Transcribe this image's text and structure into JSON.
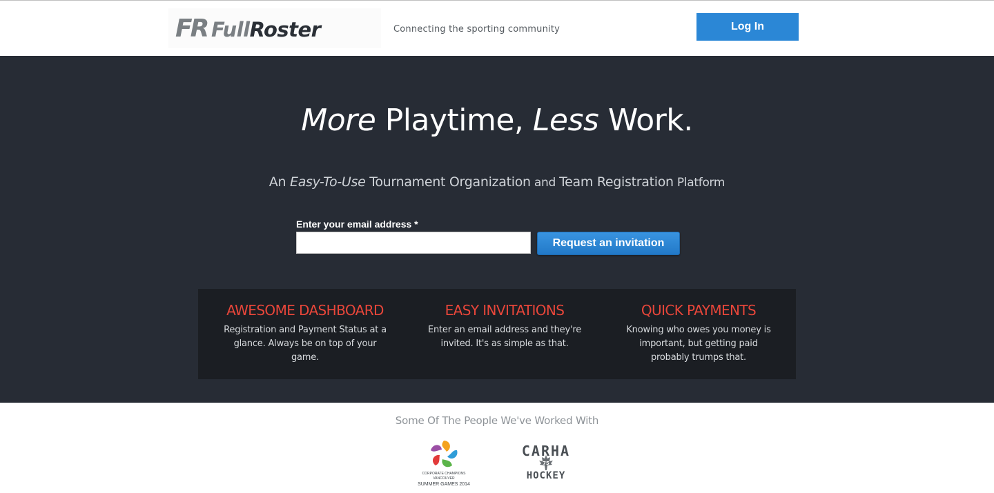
{
  "header": {
    "logo_mark": "FR",
    "logo_full": "Full",
    "logo_roster": "Roster",
    "tagline": "Connecting the sporting community",
    "login_label": "Log In"
  },
  "hero": {
    "title": {
      "w1": "More",
      "w2": " Playtime, ",
      "w3": "Less",
      "w4": " Work."
    },
    "subtitle": {
      "p1": "An ",
      "p2": "Easy-To-Use",
      "p3": " Tournament Organization",
      "p4": " and ",
      "p5": "Team Registration",
      "p6": " Platform"
    },
    "email_label": "Enter your email address *",
    "email_value": "",
    "invite_label": "Request an invitation"
  },
  "features": [
    {
      "title": "AWESOME DASHBOARD",
      "desc": "Registration and Payment Status at a glance. Always be on top of your game."
    },
    {
      "title": "EASY INVITATIONS",
      "desc": "Enter an email address and they're invited. It's as simple as that."
    },
    {
      "title": "QUICK PAYMENTS",
      "desc": "Knowing who owes you money is important, but getting paid probably trumps that."
    }
  ],
  "partners": {
    "heading": "Some Of The People We've Worked With",
    "ccg": {
      "line1": "CORPORATE CHAMPIONS VANCOUVER",
      "line2": "SUMMER GAMES 2014"
    },
    "carha": {
      "top": "CARHA",
      "badge": "75",
      "bottom": "HOCKEY"
    }
  },
  "colors": {
    "brand_blue": "#2b87d6",
    "hero_bg": "#272c35",
    "feature_bg": "#1b1e23",
    "feature_title": "#e8463a"
  }
}
